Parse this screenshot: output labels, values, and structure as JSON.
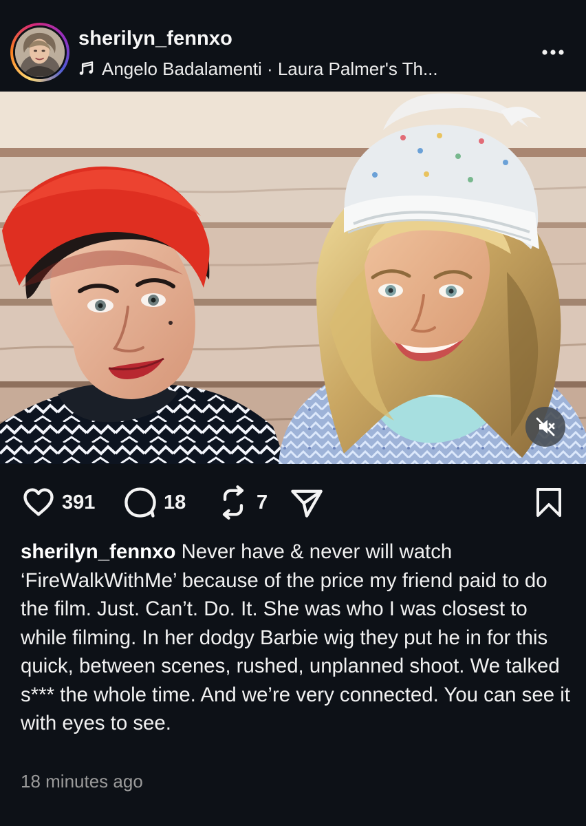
{
  "post": {
    "username": "sherilyn_fennxo",
    "music": "Angelo Badalamenti · Laura Palmer's Th...",
    "likes": "391",
    "comments": "18",
    "reposts": "7",
    "caption_username": "sherilyn_fennxo",
    "caption_text": " Never have & never will watch ‘FireWalkWithMe’ because of the price my friend paid to do the film. Just. Can’t. Do. It. She was who I was closest to while filming. In her dodgy Barbie wig they put he in for this quick, between scenes, rushed, unplanned shoot. We talked s*** the whole time. And we’re very connected. You can see it with eyes to see.",
    "timestamp": "18 minutes ago"
  },
  "icons": {
    "music": "music-note-icon",
    "more": "more-horizontal-icon",
    "mute": "muted-speaker-icon",
    "like": "heart-icon",
    "comment": "comment-icon",
    "repost": "repost-icon",
    "share": "send-icon",
    "save": "bookmark-icon"
  },
  "colors": {
    "background": "#0d1117",
    "text": "#f1f1f1",
    "secondary_text": "#9b9b9b"
  }
}
